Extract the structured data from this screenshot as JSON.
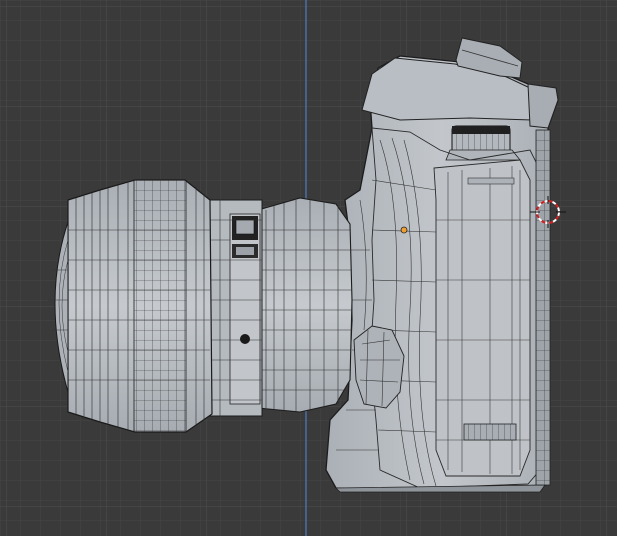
{
  "viewport": {
    "view": "orthographic-side",
    "mode": "edit-wireframe",
    "object": "camera-model",
    "colors": {
      "background": "#3a3a3a",
      "grid_minor": "#454545",
      "grid_major": "#4f4f4f",
      "axis_vertical": "#4a6fa8",
      "mesh_fill": "#b7bcc2",
      "mesh_fill_dark": "#9fa5ac",
      "wire": "#1e1e1e",
      "origin_dot": "#f0a030",
      "cursor_red": "#d22020"
    },
    "icons": [
      "3d-cursor-icon",
      "object-origin-icon"
    ]
  }
}
